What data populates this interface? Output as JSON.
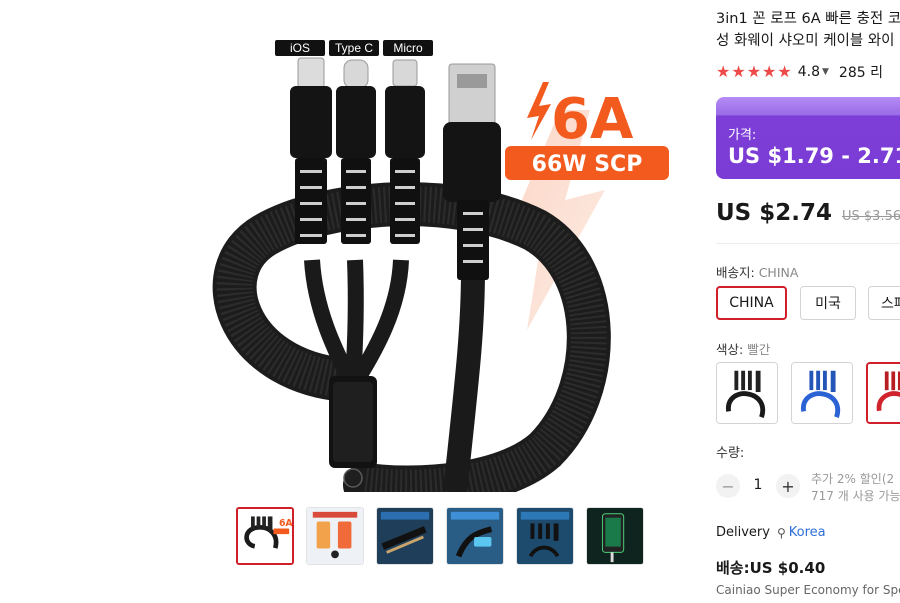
{
  "product": {
    "title_line1": "3in1 꼰 로프 6A 빠른 충전 코",
    "title_line2": "성 화웨이 샤오미 케이블 와이",
    "rating": "4.8",
    "reviews": "285 리"
  },
  "gallery": {
    "main_image_labels": {
      "port_ios": "iOS",
      "port_typec": "Type C",
      "port_micro": "Micro",
      "badge_amp": "6A",
      "badge_watt": "66W SCP"
    },
    "thumbnails": [
      "thumb-1",
      "thumb-2",
      "thumb-3",
      "thumb-4",
      "thumb-5",
      "thumb-6"
    ],
    "selected_thumbnail": 0
  },
  "price": {
    "label": "가격:",
    "range": "US $1.79 - 2.71",
    "current": "US $2.74",
    "original": "US $3.56"
  },
  "shipping_from": {
    "label": "배송지:",
    "value": "CHINA",
    "options": [
      "CHINA",
      "미국",
      "스페"
    ],
    "selected": 0
  },
  "color": {
    "label": "색상:",
    "value": "빨간",
    "swatches": [
      "black",
      "blue",
      "red"
    ],
    "selected": 2
  },
  "quantity": {
    "label": "수량:",
    "value": "1",
    "minus": "−",
    "plus": "+",
    "discount_note": "추가 2% 할인(2",
    "stock_note": "717 개 사용 가능"
  },
  "delivery": {
    "label": "Delivery",
    "pin_icon": "location-pin-icon",
    "country": "Korea"
  },
  "shipping": {
    "fee": "배송:US $0.40",
    "method": "Cainiao Super Economy for Spe"
  },
  "colors": {
    "star": "#ee4a4a",
    "selected_border": "#d11f2a",
    "price_box": "#7b3cd5",
    "link": "#2e6fd9",
    "badge_orange": "#f25a1e"
  }
}
